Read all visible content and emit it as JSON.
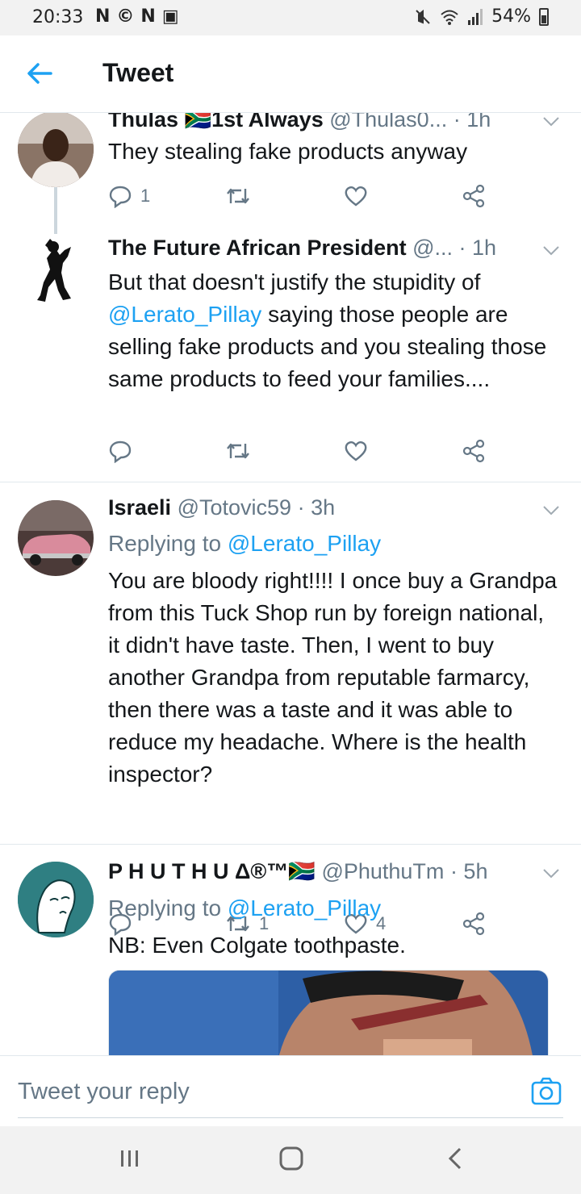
{
  "status_bar": {
    "time": "20:33",
    "left_icons": [
      "N",
      "©",
      "N",
      "▣"
    ],
    "right_icons": [
      "mute-icon",
      "wifi-icon",
      "signal-icon"
    ],
    "battery": "54%"
  },
  "header": {
    "title": "Tweet"
  },
  "tweets": [
    {
      "name": "Thulas 🇿🇦1st Always",
      "handle": "@Thulas0...",
      "time": "· 1h",
      "text": "They stealing fake products anyway",
      "reply_count": "1",
      "retweet_count": "",
      "like_count": ""
    },
    {
      "name": "The Future African President",
      "handle": "@...",
      "time": "· 1h",
      "text_parts": [
        "But that doesn't justify the stupidity of ",
        "@Lerato_Pillay",
        " saying those people are selling fake products and you stealing those same products to feed your families...."
      ],
      "reply_count": "",
      "retweet_count": "",
      "like_count": ""
    },
    {
      "name": "Israeli",
      "handle": "@Totovic59",
      "time": "· 3h",
      "replying_prefix": "Replying to ",
      "replying_to": "@Lerato_Pillay",
      "text": "You are bloody right!!!! I once buy a Grandpa from this Tuck Shop run by foreign national, it didn't have taste. Then, I went to buy another Grandpa from reputable farmarcy, then there was a taste and it was able to reduce my headache. Where is the health inspector?",
      "reply_count": "",
      "retweet_count": "1",
      "like_count": "4"
    },
    {
      "name": "P H U T H U Δ®™🇿🇦",
      "handle": "@PhuthuTm",
      "time": "· 5h",
      "replying_prefix": "Replying to ",
      "replying_to": "@Lerato_Pillay",
      "text": "NB: Even Colgate toothpaste."
    }
  ],
  "reply_composer": {
    "placeholder": "Tweet your reply"
  },
  "colors": {
    "accent": "#1da1f2",
    "secondary_text": "#657786",
    "divider": "#e1e8ed"
  },
  "nav": [
    "recent-apps-icon",
    "home-icon",
    "back-nav-icon"
  ]
}
